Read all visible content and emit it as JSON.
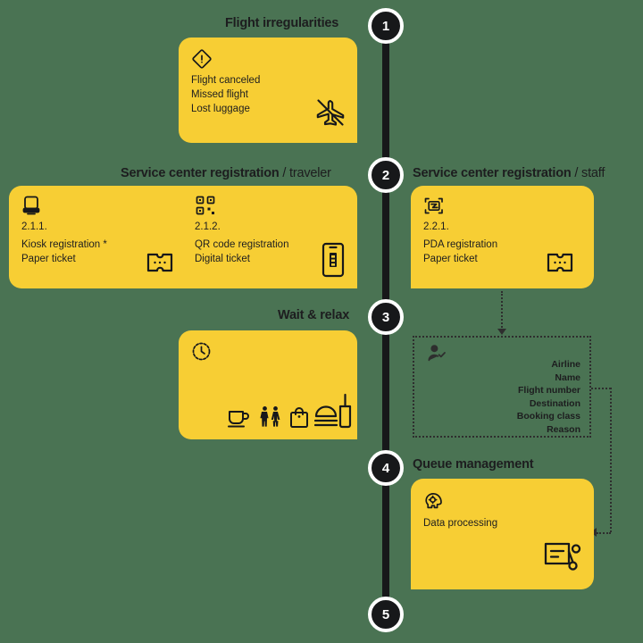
{
  "colors": {
    "background": "#4a7353",
    "card": "#f7ce34",
    "ink": "#17181a",
    "node_fill": "#17181a",
    "node_ring": "#ffffff",
    "dotted": "#2e2e2e"
  },
  "timeline": {
    "nodes": [
      {
        "number": "1"
      },
      {
        "number": "2"
      },
      {
        "number": "3"
      },
      {
        "number": "4"
      },
      {
        "number": "5"
      }
    ]
  },
  "steps": {
    "flight_irregularities": {
      "header": "Flight irregularities",
      "icon": "warning-diamond-icon",
      "lines": "Flight canceled\nMissed flight\nLost luggage",
      "decor_icon": "no-flight-icon"
    },
    "registration_traveler": {
      "header_bold": "Service center registration",
      "header_sub": " / traveler",
      "options": [
        {
          "icon": "kiosk-icon",
          "number": "2.1.1.",
          "title": "Kiosk registration *",
          "detail": "Paper ticket",
          "decor_icon": "paper-ticket-icon"
        },
        {
          "icon": "qr-code-icon",
          "number": "2.1.2.",
          "title": "QR code registration",
          "detail": "Digital ticket",
          "decor_icon": "mobile-ticket-icon"
        }
      ]
    },
    "registration_staff": {
      "header_bold": "Service center registration",
      "header_sub": " / staff",
      "icon": "pda-scanner-icon",
      "number": "2.2.1.",
      "title": "PDA registration",
      "detail": "Paper ticket",
      "decor_icon": "paper-ticket-icon"
    },
    "wait_relax": {
      "header": "Wait & relax",
      "icon": "clock-icon",
      "amenities": [
        "cafe-icon",
        "restroom-icon",
        "shop-icon",
        "food-icon"
      ]
    },
    "data_group": {
      "icon": "passenger-data-icon",
      "fields": "Airline\nName\nFlight number\nDestination\nBooking class\nReason"
    },
    "queue_management": {
      "header": "Queue management",
      "icon": "data-processing-icon",
      "label": "Data processing",
      "decor_icon": "ticket-queue-icon"
    }
  }
}
